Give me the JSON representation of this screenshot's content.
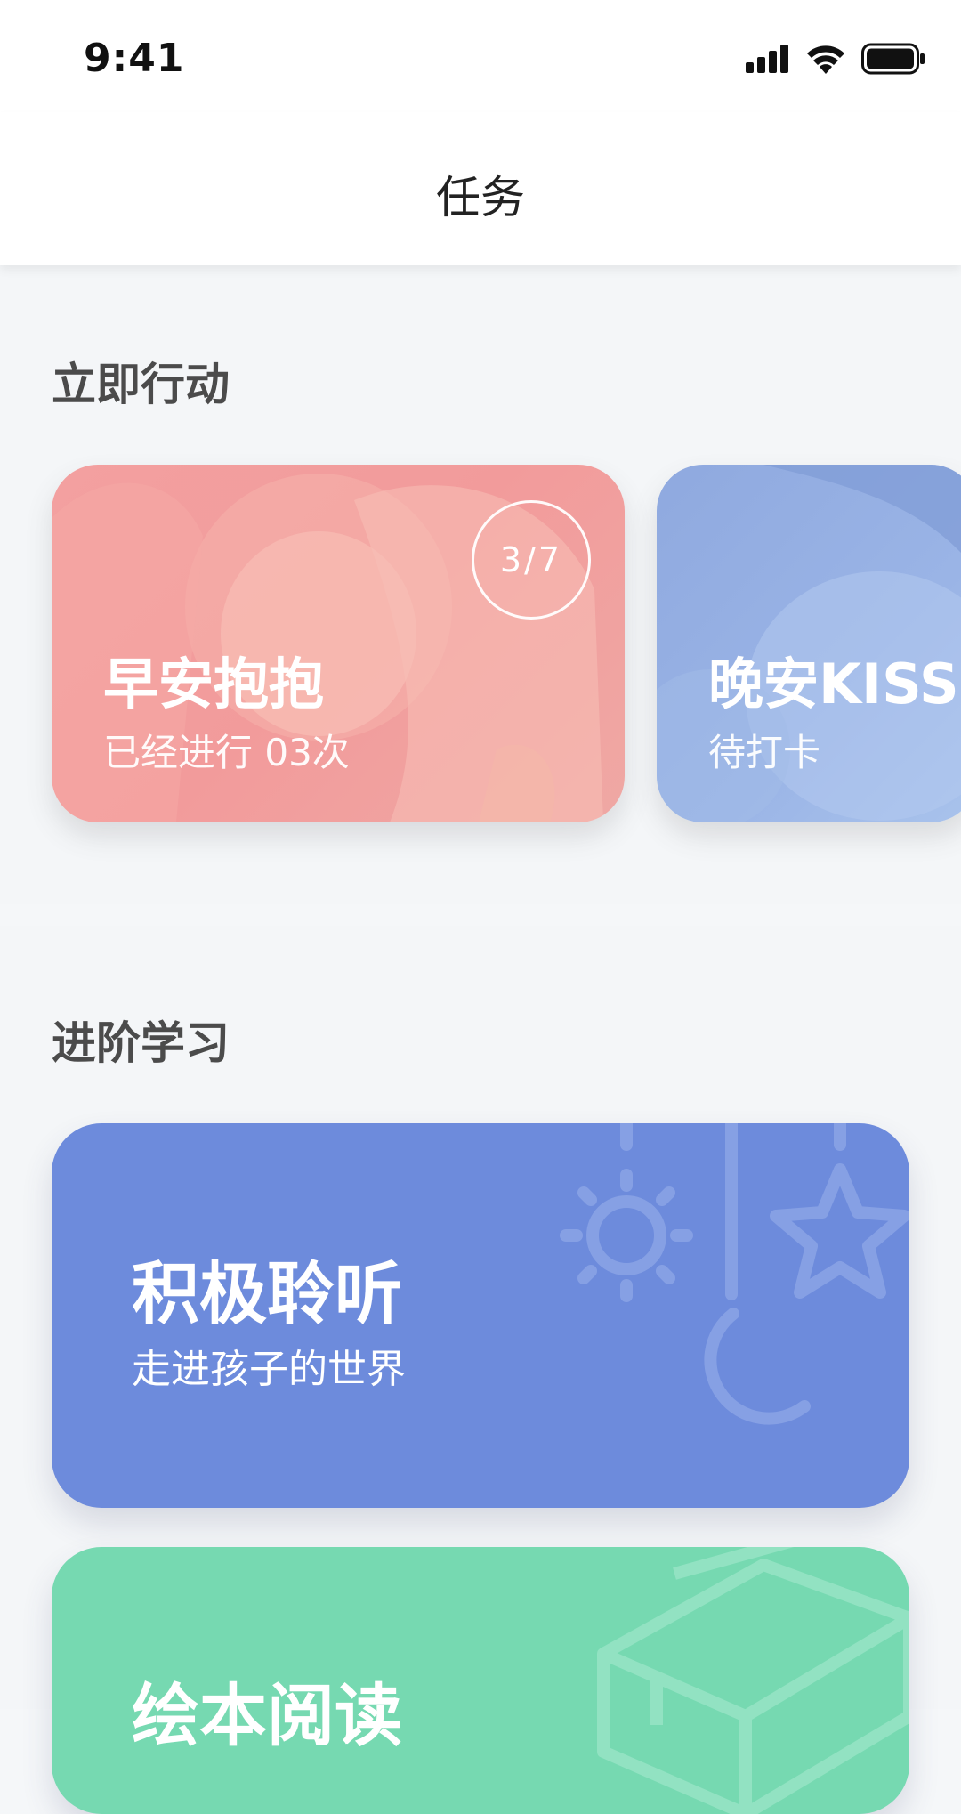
{
  "status": {
    "time": "9:41"
  },
  "nav": {
    "title": "任务"
  },
  "section_action": {
    "title": "立即行动",
    "cards": [
      {
        "title": "早安抱抱",
        "subtitle": "已经进行 03次",
        "progress": "3/7",
        "progress_fraction": 0.4286,
        "color": "#f29b9b"
      },
      {
        "title": "晚安KISS",
        "subtitle": "待打卡",
        "color": "#9ab4e6"
      }
    ]
  },
  "section_study": {
    "title": "进阶学习",
    "cards": [
      {
        "title": "积极聆听",
        "subtitle": "走进孩子的世界",
        "color": "#6d8bdc",
        "icons": [
          "sun-icon",
          "star-icon",
          "moon-icon"
        ]
      },
      {
        "title": "绘本阅读",
        "color": "#76d9b1",
        "icons": [
          "book-icon"
        ]
      }
    ]
  }
}
